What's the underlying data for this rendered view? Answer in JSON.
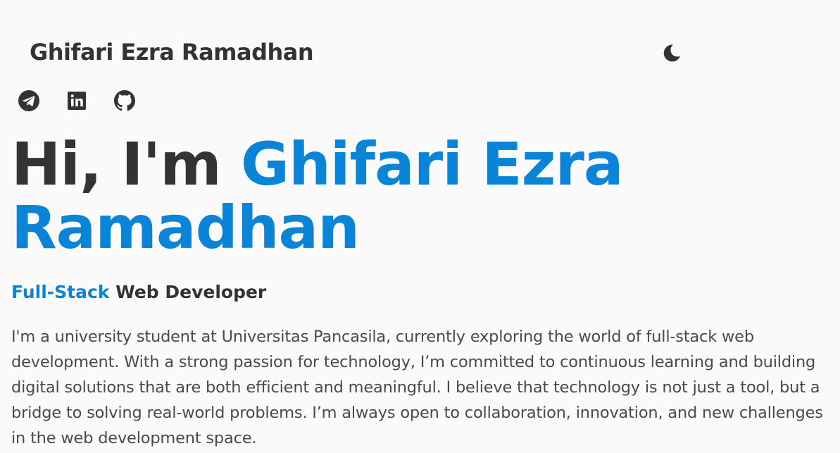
{
  "header": {
    "site_name": "Ghifari Ezra Ramadhan",
    "theme_toggle_icon": "moon-icon"
  },
  "socials": [
    {
      "name": "telegram",
      "icon": "telegram-icon"
    },
    {
      "name": "linkedin",
      "icon": "linkedin-icon"
    },
    {
      "name": "github",
      "icon": "github-icon"
    }
  ],
  "hero": {
    "greeting": "Hi, I'm ",
    "name": "Ghifari Ezra Ramadhan",
    "role_highlight": "Full-Stack",
    "role_rest": " Web Developer",
    "bio": "I'm a university student at Universitas Pancasila, currently exploring the world of full-stack web development. With a strong passion for technology, I’m committed to continuous learning and building digital solutions that are both efficient and meaningful. I believe that technology is not just a tool, but a bridge to solving real-world problems. I’m always open to collaboration, innovation, and new challenges in the web development space."
  },
  "colors": {
    "accent": "#0984d6",
    "text": "#333333",
    "background": "#fafafa"
  }
}
